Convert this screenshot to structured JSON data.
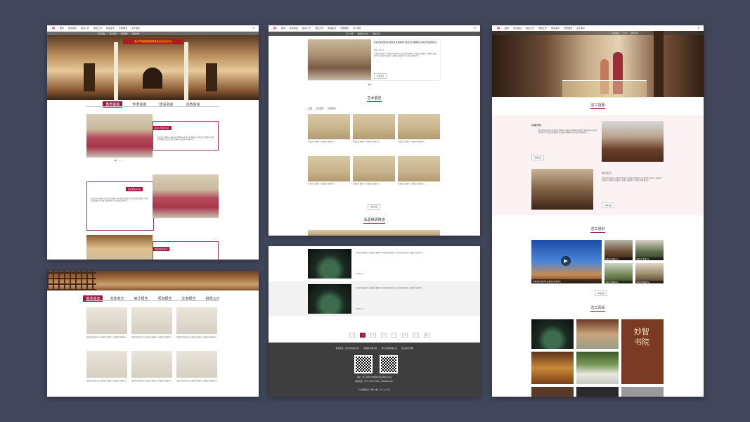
{
  "nav_items": [
    "首页",
    "慈善项目",
    "信息公开",
    "党建工作",
    "新闻资讯",
    "志愿服务",
    "关于我们"
  ],
  "panel_a": {
    "subnav": [
      "慈善基金",
      "开心基金",
      "国际基金",
      "特殊基金"
    ],
    "banner_text": "温州市苍南县慈善基金会文化活动中心",
    "tabs": [
      "教育基金",
      "怀老基金",
      "建设基金",
      "急救基金"
    ],
    "active_tab": 0,
    "items": [
      {
        "title": "融善公司慈善项目",
        "text": "欢迎文化传播中心温州文化传播中心欢迎文化传播中心欢迎文化传播中心欢迎文化传播中心欢迎文化传播中心欢迎文化传播中心"
      },
      {
        "title": "慈善周慈善公益",
        "text": "欢迎文化传播中心温州文化传播中心欢迎文化传播中心欢迎文化传播中心欢迎文化传播中心欢迎文化传播中心欢迎文化传播中心"
      },
      {
        "title": "融善周慈善项目",
        "text": ""
      }
    ]
  },
  "panel_b": {
    "tabs": [
      "基本信息",
      "善款收支",
      "审计报告",
      "项目报告",
      "年度报告",
      "捐赠公示"
    ],
    "active_tab": 0,
    "cards": [
      {
        "text": "永嘉文化发展中心永嘉文化发展中心永嘉文化发展中心"
      },
      {
        "text": "永嘉文化发展中心永嘉文化发展中心永嘉文化发展中心"
      },
      {
        "text": "永嘉文化发展中心永嘉文化发展中心永嘉文化发展中心"
      },
      {
        "text": "永嘉文化发展中心永嘉文化发展中心永嘉文化发展中心"
      },
      {
        "text": "永嘉文化发展中心永嘉文化发展中心永嘉文化发展中心"
      },
      {
        "text": "永嘉文化发展中心永嘉文化发展中心永嘉文化发展中心"
      }
    ]
  },
  "panel_c": {
    "subnav": [
      "达人介绍",
      "永嘉时代活动",
      "新闻资讯"
    ],
    "news_title": "永嘉文化发展中心永嘉文化发展中心永嘉文化发展中心永嘉文化发展中心",
    "news_date": "2021-01-01",
    "news_body": "永嘉文化发展中心永嘉文化发展中心永嘉文化发展中心永嘉文化发展中心永嘉文化发展中心永嘉文化发展中心永嘉文化发展中心永嘉文化发展中心",
    "more": "查看更多",
    "section1": "艺术展览",
    "filters": [
      "全部",
      "正在展览",
      "往期展览"
    ],
    "card_text": "永嘉文化发展中心永嘉文化发展中心",
    "section2": "永嘉禅研修班"
  },
  "panel_d": {
    "rows": [
      {
        "text": "永嘉文化发展中心永嘉文化发展中心永嘉文化发展中心永嘉文化发展中心永嘉文化发展中心",
        "date": "2021-01"
      },
      {
        "text": "永嘉文化发展中心永嘉文化发展中心永嘉文化发展中心永嘉文化发展中心永嘉文化发展中心",
        "date": "2021-01"
      }
    ],
    "pages": [
      "<",
      "1",
      "2",
      "3",
      "...",
      "8",
      ">",
      "跳"
    ],
    "footer_links": [
      "友情链接：温州市慈善总会",
      "中国慈善联合会",
      "浙江省慈善联合会",
      "温州仙岩书院"
    ],
    "address": "地址：浙江省温州市瓯海区仙岩镇仙岩街道",
    "phone": "联系电话：0577-86770388 / 18968887367",
    "copyright": "工信部备案号：浙ICP备11111111号-2"
  },
  "panel_e": {
    "subnav": [
      "大美仙岩",
      "工坊",
      "研学活动"
    ],
    "section1": "志工招募",
    "recruit_title": "招募须知",
    "join_title": "加入志工",
    "text": "永嘉文化发展中心永嘉文化发展中心永嘉文化发展中心永嘉文化发展中心永嘉文化发展中心永嘉文化发展中心永嘉文化发展中心永嘉文化发展中心",
    "more": "查看更多",
    "section2": "志工培训",
    "video_caption": "永嘉文化发展中心永嘉文化发展中心",
    "thumb_caption": "永嘉文化发展中心",
    "section3": "志工风采",
    "calligraphy": "妙智书院"
  }
}
